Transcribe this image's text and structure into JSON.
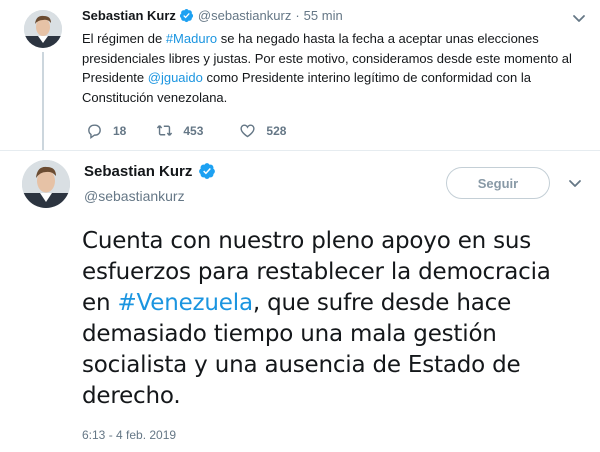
{
  "quoted_tweet": {
    "author_name": "Sebastian Kurz",
    "author_handle": "@sebastiankurz",
    "separator": "·",
    "time_ago": "55 min",
    "text_parts": [
      "El régimen de ",
      "#Maduro",
      " se ha negado hasta la fecha a aceptar unas elecciones presidenciales libres y justas. Por este motivo, consideramos desde este momento al Presidente ",
      "@jguaido",
      " como Presidente interino legítimo de conformidad con la Constitución venezolana."
    ],
    "actions": {
      "replies": "18",
      "retweets": "453",
      "likes": "528"
    }
  },
  "main_tweet": {
    "author_name": "Sebastian Kurz",
    "author_handle": "@sebastiankurz",
    "follow_label": "Seguir",
    "text_parts": [
      "Cuenta con nuestro pleno apoyo en sus esfuerzos para restablecer la democracia en ",
      "#Venezuela",
      ", que sufre desde hace demasiado tiempo una mala gestión socialista y una ausencia de Estado de derecho."
    ],
    "timestamp": "6:13 - 4 feb. 2019"
  },
  "colors": {
    "link": "#1b95e0",
    "secondary_text": "#657786",
    "verified_badge": "#1da1f2"
  },
  "icons": [
    "verified-badge-icon",
    "chevron-down-icon",
    "reply-icon",
    "retweet-icon",
    "like-icon"
  ]
}
